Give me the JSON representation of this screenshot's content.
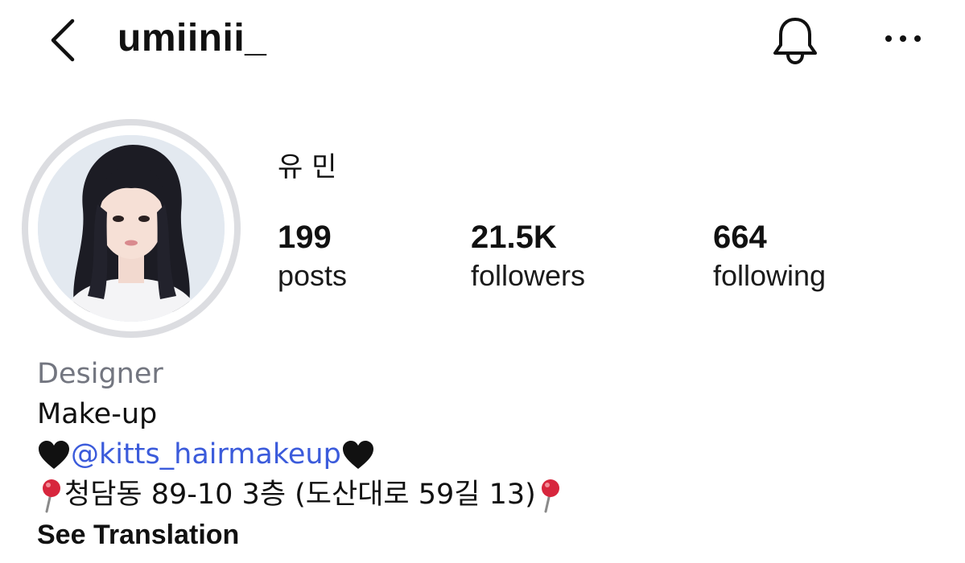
{
  "header": {
    "username": "umiinii_",
    "back_icon": "chevron-left-icon",
    "notifications_icon": "bell-icon",
    "more_icon": "more-horizontal-icon"
  },
  "profile": {
    "avatar_icon": "profile-avatar",
    "display_name": "유 민",
    "stats": [
      {
        "count": "199",
        "label": "posts"
      },
      {
        "count": "21.5K",
        "label": "followers"
      },
      {
        "count": "664",
        "label": "following"
      }
    ]
  },
  "bio": {
    "category": "Designer",
    "line1": "Make-up",
    "mention": "@kitts_hairmakeup",
    "mention_emoji": "black-heart-icon",
    "address": "청담동 89-10 3층 (도산대로 59길 13)",
    "address_emoji": "round-pushpin-icon",
    "see_translation": "See Translation"
  },
  "colors": {
    "link": "#3b5bdb",
    "muted": "#737680",
    "avatar_ring": "#dcdde1",
    "pin": "#d7263d"
  }
}
